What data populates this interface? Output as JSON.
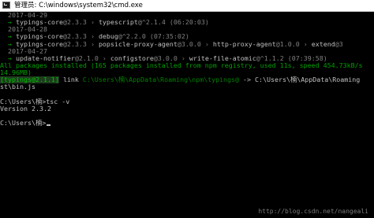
{
  "window": {
    "title": "管理员: C:\\windows\\system32\\cmd.exe"
  },
  "console": {
    "line1_date": "2017-04-29",
    "line2_arrow": "→",
    "line2_a": "typings-core",
    "line2_a_ver": "@2.3.3",
    "line2_sep": "›",
    "line2_b": "typescript",
    "line2_b_ver": "@^2.1.4",
    "line2_time": "(06:20:03)",
    "line3_date": "2017-04-28",
    "line4_a": "typings-core",
    "line4_a_ver": "@2.3.3",
    "line4_b": "debug",
    "line4_b_ver": "@^2.2.0",
    "line4_time": "(07:35:02)",
    "line5_a": "typings-core",
    "line5_a_ver": "@2.3.3",
    "line5_b": "popsicle-proxy-agent",
    "line5_b_ver": "@3.0.0",
    "line5_c": "http-proxy-agent",
    "line5_c_ver": "@1.0.0",
    "line5_d": "extend",
    "line5_d_ver": "@3",
    "line6_date": "2017-04-27",
    "line7_a": "update-notifier",
    "line7_a_ver": "@2.1.0",
    "line7_b": "configstore",
    "line7_b_ver": "@3.0.0",
    "line7_c": "write-file-atomic",
    "line7_c_ver": "@^1.1.2",
    "line7_time": "(07:39:58)",
    "line8": "All packages installed (165 packages installed from npm registry, used 11s, speed 454.73kB/s",
    "line9": "14.96MB)",
    "line10_pkg": "[typings@2.1.1]",
    "line10_link": "link",
    "line10_path": "C:\\Users\\楠\\AppData\\Roaming\\npm\\typings@",
    "line10_arrow": "->",
    "line10_target": "C:\\Users\\楠\\AppData\\Roaming",
    "line11": "st\\bin.js",
    "line12": "",
    "line13": "C:\\Users\\楠>tsc -v",
    "line14": "Version 2.3.2",
    "line15": "",
    "line16_prompt": "C:\\Users\\楠>"
  },
  "watermark": "http://blog.csdn.net/nangeali"
}
